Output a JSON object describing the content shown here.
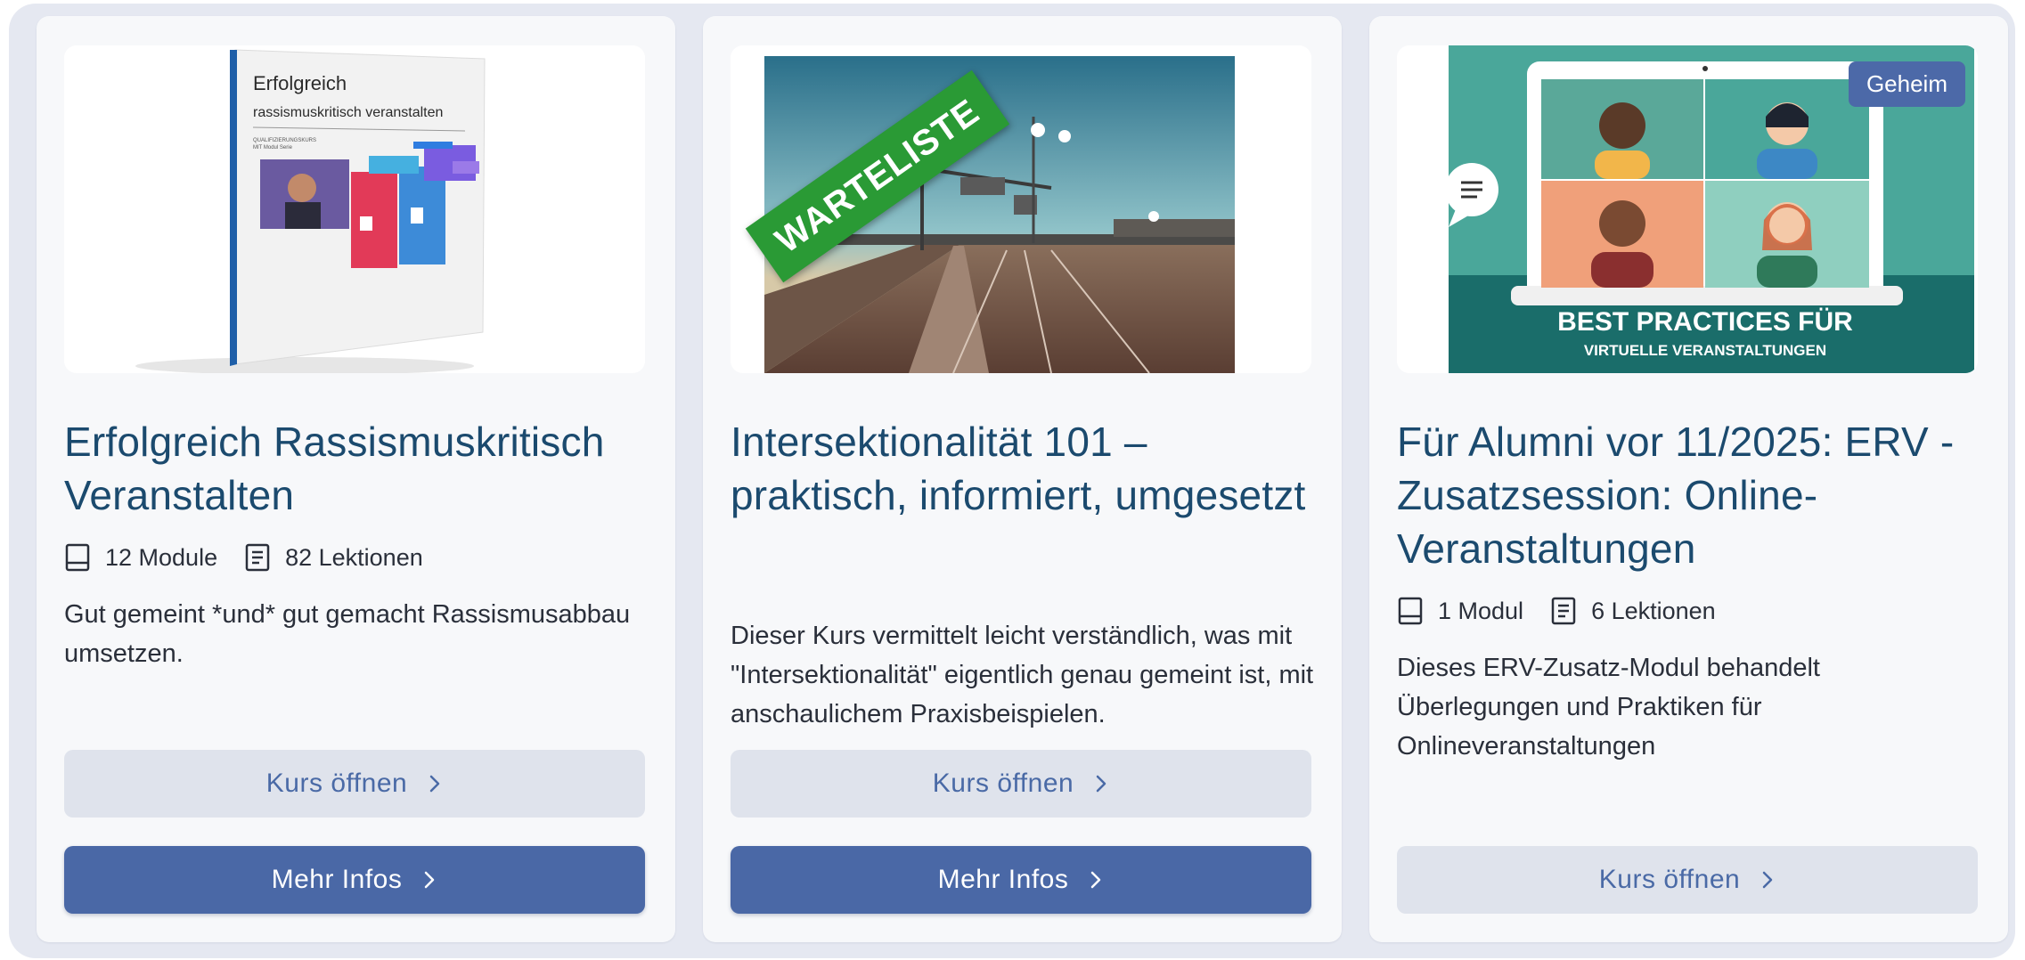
{
  "cards": [
    {
      "title": "Erfolgreich Rassismuskritisch Veranstalten",
      "modules": "12 Module",
      "lessons": "82 Lektionen",
      "description": "Gut gemeint *und* gut gemacht Rassismusabbau umsetzen.",
      "open_button": "Kurs öffnen",
      "info_button": "Mehr Infos",
      "cover": {
        "title_line1": "Erfolgreich",
        "title_line2": "rassismuskritisch veranstalten",
        "subtitle_line1": "QUALIFIZIERUNGSKURS",
        "subtitle_line2": "MIT Modul Serie"
      }
    },
    {
      "title": "Intersektionalität 101 – praktisch, informiert, umgesetzt",
      "description": "Dieser Kurs vermittelt leicht verständlich, was mit \"Intersektionalität\" eigentlich genau gemeint ist, mit anschaulichem Praxisbeispielen.",
      "open_button": "Kurs öffnen",
      "info_button": "Mehr Infos",
      "ribbon": "WARTELISTE"
    },
    {
      "title": "Für Alumni vor 11/2025: ERV - Zusatzsession: Online-Veranstaltungen",
      "modules": "1 Modul",
      "lessons": "6 Lektionen",
      "description": "Dieses ERV-Zusatz-Modul behandelt Überlegungen und Praktiken für Onlineveranstaltungen",
      "open_button": "Kurs öffnen",
      "badge": "Geheim",
      "image_line1": "BEST PRACTICES FÜR",
      "image_line2": "VIRTUELLE VERANSTALTUNGEN"
    }
  ],
  "colors": {
    "title": "#1b4a6e",
    "primary": "#4a68a6",
    "secondary_bg": "#dfe3ec",
    "frame": "#e5e8f1",
    "ribbon": "#2a9a35",
    "teal": "#4aa79a"
  },
  "icons": {
    "modules": "book-icon",
    "lessons": "document-icon",
    "button": "chevron-right-icon"
  }
}
